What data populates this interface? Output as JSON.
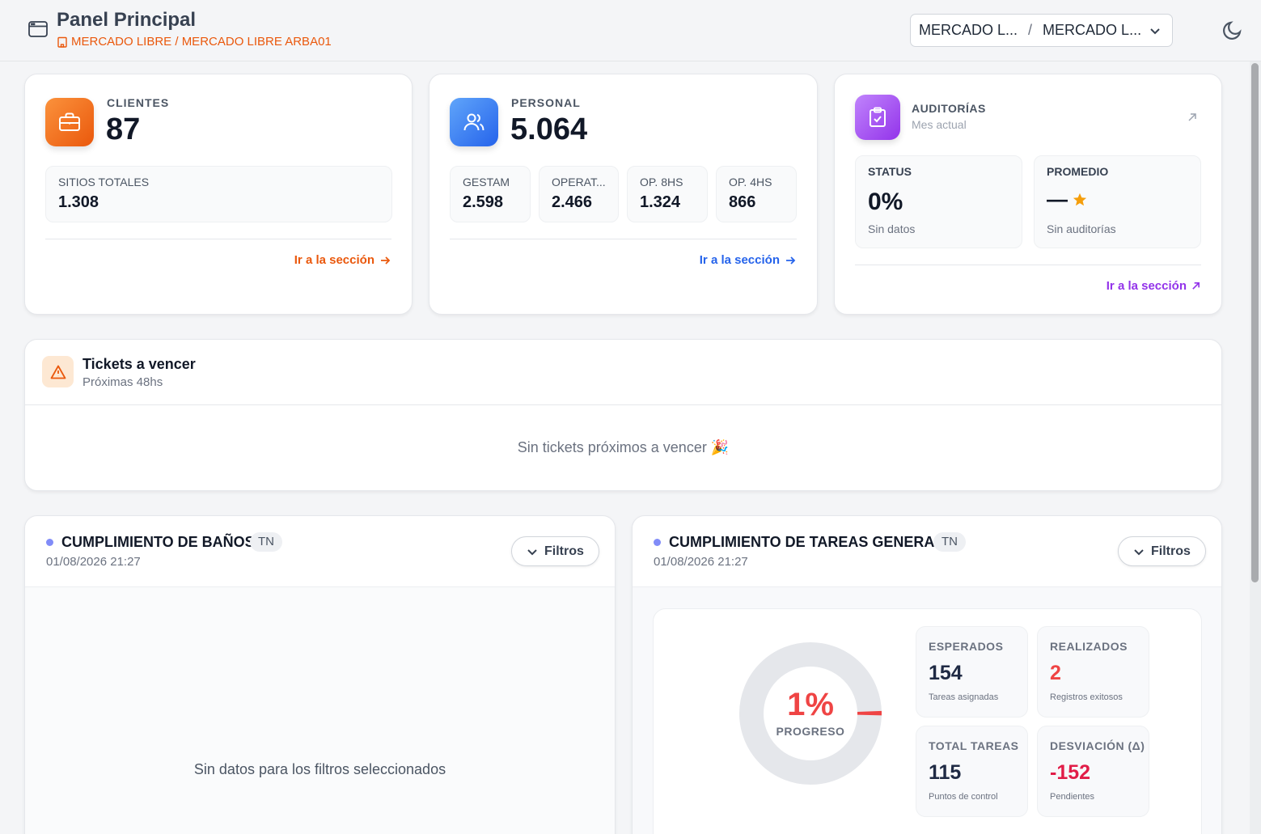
{
  "header": {
    "title": "Panel Principal",
    "breadcrumb": "MERCADO LIBRE / MERCADO LIBRE ARBA01",
    "selector": {
      "client": "MERCADO L...",
      "separator": "/",
      "site": "MERCADO L..."
    }
  },
  "clientes": {
    "label": "CLIENTES",
    "value": "87",
    "sub": {
      "label": "SITIOS TOTALES",
      "value": "1.308"
    },
    "link": "Ir a la sección"
  },
  "personal": {
    "label": "PERSONAL",
    "value": "5.064",
    "subs": [
      {
        "label": "GESTAM",
        "value": "2.598"
      },
      {
        "label": "OPERAT...",
        "value": "2.466"
      },
      {
        "label": "OP. 8HS",
        "value": "1.324"
      },
      {
        "label": "OP. 4HS",
        "value": "866"
      }
    ],
    "link": "Ir a la sección"
  },
  "auditorias": {
    "label": "AUDITORÍAS",
    "sublabel": "Mes actual",
    "status": {
      "label": "STATUS",
      "value": "0%",
      "note": "Sin datos"
    },
    "promedio": {
      "label": "PROMEDIO",
      "value": "—",
      "note": "Sin auditorías"
    },
    "link": "Ir a la sección"
  },
  "tickets": {
    "title": "Tickets a vencer",
    "subtitle": "Próximas 48hs",
    "empty": "Sin tickets próximos a vencer 🎉"
  },
  "banos": {
    "title": "CUMPLIMIENTO DE BAÑOS",
    "badge": "TN",
    "date": "01/08/2026 21:27",
    "filter": "Filtros",
    "empty": "Sin datos para los filtros seleccionados"
  },
  "tareas": {
    "title": "CUMPLIMIENTO DE TAREAS GENERAL",
    "badge": "TN",
    "date": "01/08/2026 21:27",
    "filter": "Filtros",
    "progress": {
      "value": "1%",
      "fraction": 0.01,
      "label": "PROGRESO"
    },
    "metrics": [
      {
        "label": "ESPERADOS",
        "value": "154",
        "note": "Tareas asignadas",
        "color": "#1f2a44"
      },
      {
        "label": "REALIZADOS",
        "value": "2",
        "note": "Registros exitosos",
        "color": "#ef4444"
      },
      {
        "label": "TOTAL TAREAS",
        "value": "115",
        "note": "Puntos de control",
        "color": "#1f2a44"
      },
      {
        "label": "DESVIACIÓN (Δ)",
        "value": "-152",
        "note": "Pendientes",
        "color": "#e11d48"
      }
    ]
  },
  "colors": {
    "orange": "#ea580c",
    "blue": "#2563eb",
    "purple": "#9333ea",
    "red": "#ef4444"
  }
}
